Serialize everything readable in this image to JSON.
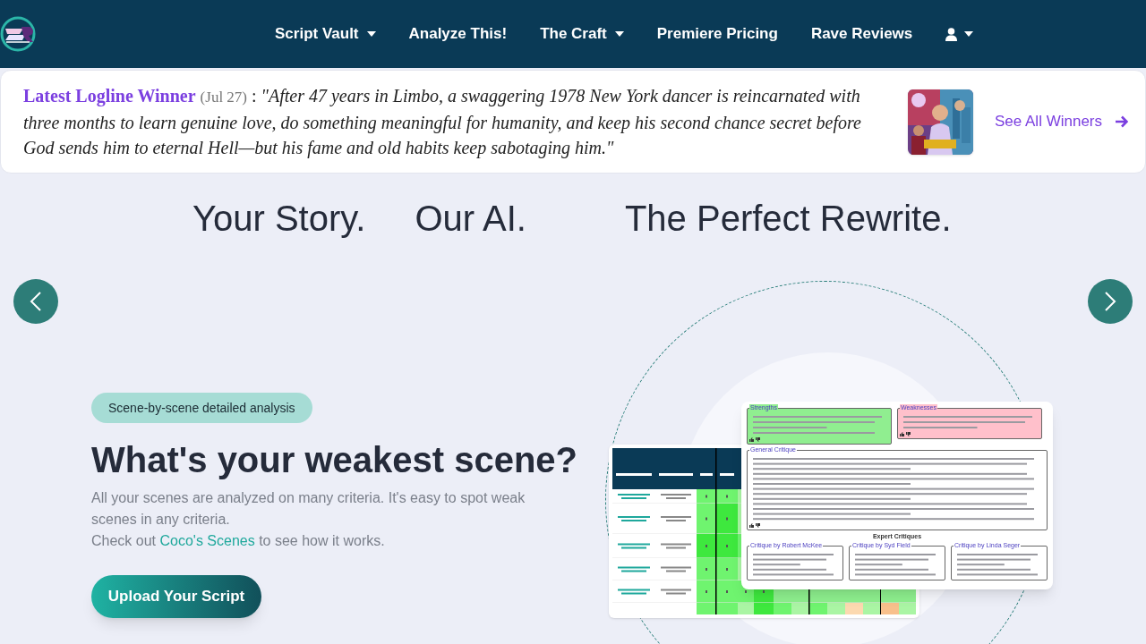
{
  "nav": {
    "items": [
      {
        "label": "Script Vault",
        "dropdown": true
      },
      {
        "label": "Analyze This!",
        "dropdown": false
      },
      {
        "label": "The Craft",
        "dropdown": true
      },
      {
        "label": "Premiere Pricing",
        "dropdown": false
      },
      {
        "label": "Rave Reviews",
        "dropdown": false
      }
    ],
    "user_menu": {
      "dropdown": true
    }
  },
  "logline": {
    "title": "Latest Logline Winner",
    "date": "(Jul 27)",
    "separator": ":",
    "text": "\"After 47 years in Limbo, a swaggering 1978 New York dancer is reincarnated with three months to learn genuine love, do something meaningful for humanity, and keep his second chance secret before God sends him to eternal Hell—but his fame and old habits keep sabotaging him.\"",
    "link": "See All Winners"
  },
  "headline": [
    "Your Story.",
    "Our AI.",
    "The Perfect Rewrite."
  ],
  "slide": {
    "badge": "Scene-by-scene detailed analysis",
    "heading": "What's your weakest scene?",
    "description": "All your scenes are analyzed on many criteria. It's easy to spot weak scenes in any criteria.",
    "cta_prefix": "Check out",
    "cta_link": "Coco's Scenes",
    "cta_suffix": "to see how it works.",
    "button": "Upload Your Script"
  },
  "preview": {
    "strengths": "Strengths",
    "weaknesses": "Weaknesses",
    "general": "General Critique",
    "expert_title": "Expert Critiques",
    "experts": [
      "Critique by Robert McKee",
      "Critique by Syd Field",
      "Critique by Linda Seger"
    ]
  }
}
